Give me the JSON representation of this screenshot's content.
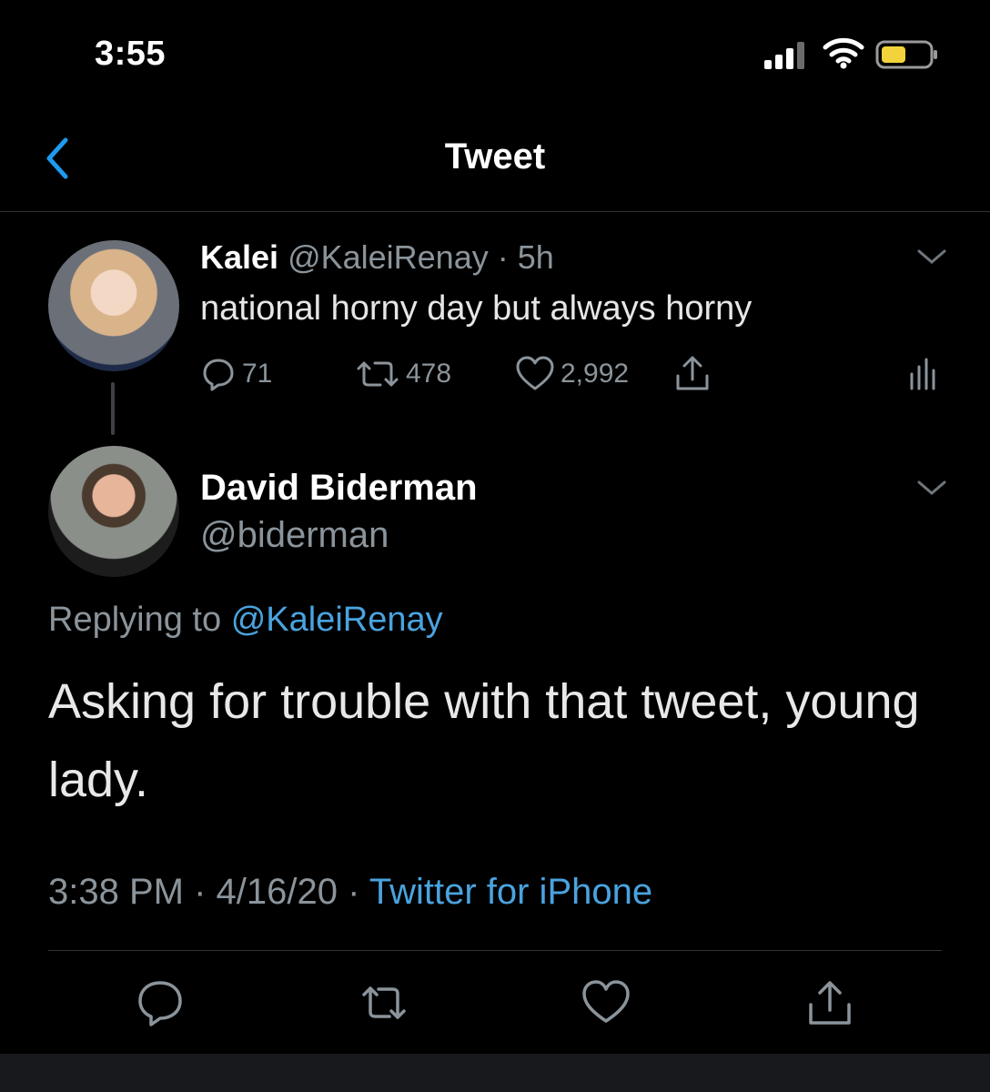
{
  "status_bar": {
    "time": "3:55",
    "battery_color": "#f3d33c"
  },
  "header": {
    "title": "Tweet",
    "back_icon": "chevron-left-icon",
    "accent": "#1d9bf0"
  },
  "original_tweet": {
    "name": "Kalei",
    "handle": "@KaleiRenay",
    "separator": "·",
    "age": "5h",
    "text": "national horny day but always horny",
    "replies": "71",
    "retweets": "478",
    "likes": "2,992"
  },
  "reply_tweet": {
    "name": "David Biderman",
    "handle": "@biderman",
    "replying_prefix": "Replying to",
    "replying_to": "@KaleiRenay",
    "text": "Asking for trouble with that tweet, young lady.",
    "time": "3:38 PM",
    "sep1": "·",
    "date": "4/16/20",
    "sep2": "·",
    "source": "Twitter for iPhone"
  },
  "colors": {
    "link": "#4aa3df",
    "muted": "#8b949b",
    "background": "#000000"
  }
}
